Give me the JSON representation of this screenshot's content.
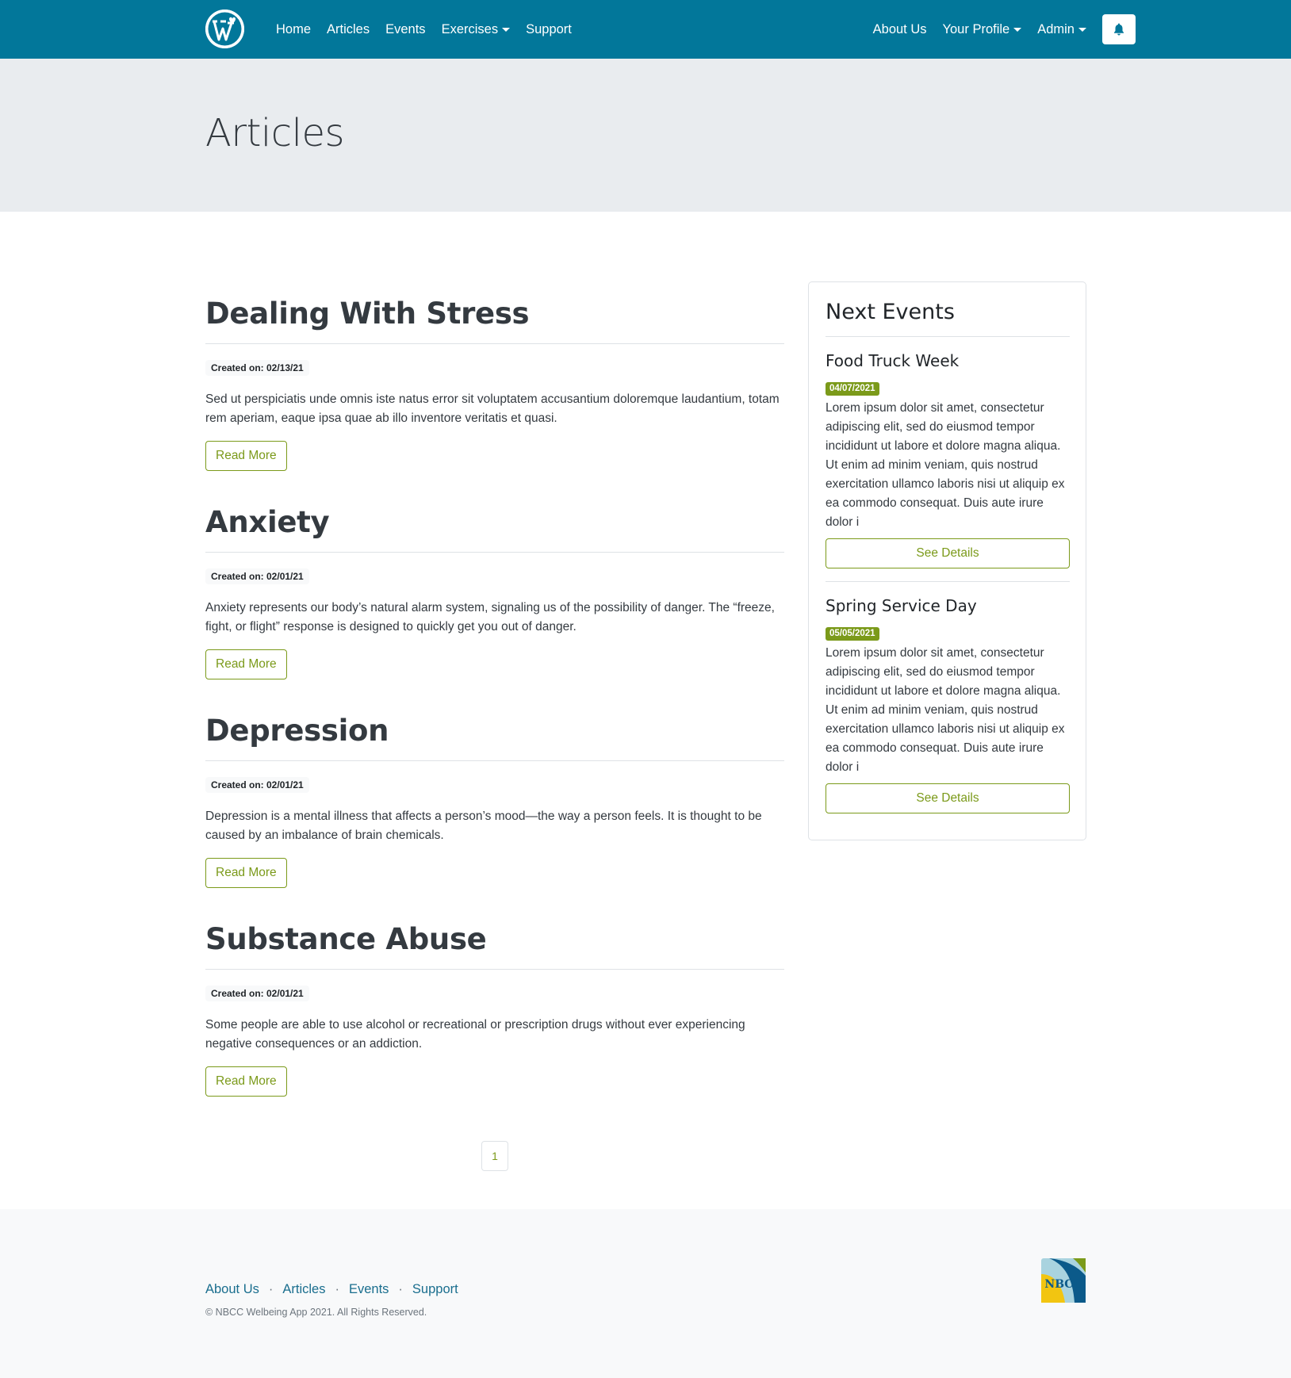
{
  "nav": {
    "logo": "wordpress-logo",
    "left": [
      "Home",
      "Articles",
      "Events",
      "Exercises",
      "Support"
    ],
    "right": [
      "About Us",
      "Your Profile",
      "Admin"
    ]
  },
  "header": {
    "title": "Articles"
  },
  "articles": [
    {
      "title": "Dealing With Stress",
      "created": "Created on: 02/13/21",
      "excerpt": "Sed ut perspiciatis unde omnis iste natus error sit voluptatem accusantium doloremque laudantium, totam rem aperiam, eaque ipsa quae ab illo inventore veritatis et quasi.",
      "button": "Read More"
    },
    {
      "title": "Anxiety",
      "created": "Created on: 02/01/21",
      "excerpt": "Anxiety represents our body’s natural alarm system, signaling us of the possibility of danger. The “freeze, fight, or flight” response is designed to quickly get you out of danger.",
      "button": "Read More"
    },
    {
      "title": "Depression",
      "created": "Created on: 02/01/21",
      "excerpt": "Depression is a mental illness that affects a person’s mood—the way a person feels. It is thought to be caused by an imbalance of brain chemicals.",
      "button": "Read More"
    },
    {
      "title": "Substance Abuse",
      "created": "Created on: 02/01/21",
      "excerpt": "Some people are able to use alcohol or recreational or prescription drugs without ever experiencing negative consequences or an addiction.",
      "button": "Read More"
    }
  ],
  "sidebar": {
    "title": "Next Events",
    "events": [
      {
        "title": "Food Truck Week",
        "date": "04/07/2021",
        "text": "Lorem ipsum dolor sit amet, consectetur adipiscing elit, sed do eiusmod tempor incididunt ut labore et dolore magna aliqua. Ut enim ad minim veniam, quis nostrud exercitation ullamco laboris nisi ut aliquip ex ea commodo consequat. Duis aute irure dolor i",
        "button": "See Details"
      },
      {
        "title": "Spring Service Day",
        "date": "05/05/2021",
        "text": "Lorem ipsum dolor sit amet, consectetur adipiscing elit, sed do eiusmod tempor incididunt ut labore et dolore magna aliqua. Ut enim ad minim veniam, quis nostrud exercitation ullamco laboris nisi ut aliquip ex ea commodo consequat. Duis aute irure dolor i",
        "button": "See Details"
      }
    ]
  },
  "pagination": {
    "current": "1"
  },
  "footer": {
    "links": [
      "About Us",
      "Articles",
      "Events",
      "Support"
    ],
    "separator": "·",
    "copyright": "© NBCC Welbeing App 2021. All Rights Reserved.",
    "logo_text": "NBCC"
  },
  "colors": {
    "navbar": "#02779a",
    "accent": "#7b9a1a",
    "jumbotron": "#e9ecef",
    "footer_bg": "#f8f9fa"
  }
}
